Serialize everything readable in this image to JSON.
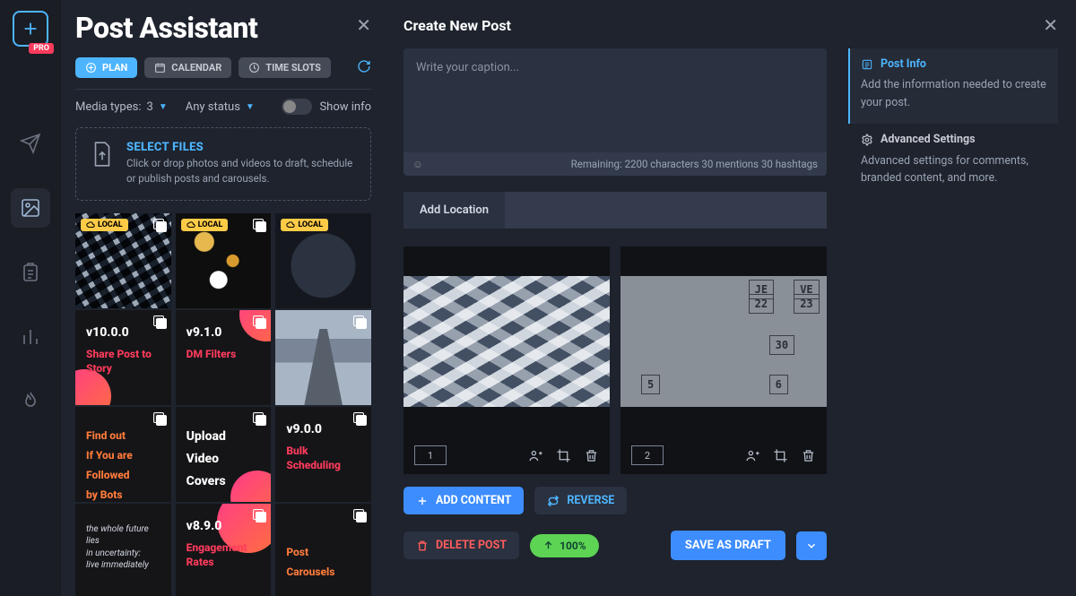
{
  "rail": {
    "pro": "PRO"
  },
  "left": {
    "title": "Post Assistant",
    "tabs": {
      "plan": "PLAN",
      "calendar": "CALENDAR",
      "timeslots": "TIME SLOTS"
    },
    "filters": {
      "media_label": "Media types:",
      "media_count": "3",
      "status": "Any status",
      "showinfo": "Show info"
    },
    "dropzone": {
      "title": "SELECT FILES",
      "sub": "Click or drop photos and videos to draft, schedule or publish posts and carousels."
    },
    "local_badge": "LOCAL",
    "cards": {
      "v10": {
        "ver": "v10.0.0",
        "t": "Share Post to Story"
      },
      "v91": {
        "ver": "v9.1.0",
        "t": "DM Filters"
      },
      "bots": {
        "t1": "Find out",
        "t2": "If You are",
        "t3": "Followed",
        "t4": "by Bots"
      },
      "upload": {
        "t1": "Upload",
        "t2": "Video",
        "t3": "Covers"
      },
      "v90": {
        "ver": "v9.0.0",
        "t": "Bulk Scheduling"
      },
      "quote": {
        "t1": "the whole future lies",
        "t2": "in uncertainty:",
        "t3": "live immediately"
      },
      "v89": {
        "ver": "v8.9.0",
        "t": "Engagement Rates"
      },
      "car": {
        "t1": "Post",
        "t2": "Carousels"
      }
    }
  },
  "right": {
    "title": "Create New Post",
    "caption_placeholder": "Write your caption...",
    "caption_remaining": "Remaining: 2200 characters 30 mentions 30 hashtags",
    "add_location": "Add Location",
    "content": {
      "num1": "1",
      "num2": "2"
    },
    "buttons": {
      "add_content": "ADD CONTENT",
      "reverse": "REVERSE",
      "delete": "DELETE POST",
      "upload_pct": "100%",
      "save": "SAVE AS DRAFT"
    },
    "info": {
      "post_info_t": "Post Info",
      "post_info_d": "Add the information needed to create your post.",
      "adv_t": "Advanced Settings",
      "adv_d": "Advanced settings for comments, branded content, and more."
    },
    "cal": {
      "je": "JE",
      "n22": "22",
      "ve": "VE",
      "n23": "23",
      "n30": "30",
      "n5": "5",
      "n6": "6"
    }
  }
}
